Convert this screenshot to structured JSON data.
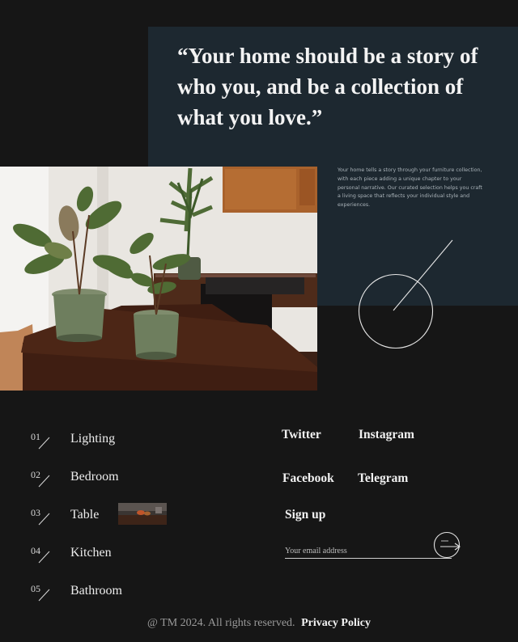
{
  "hero": {
    "quote": "“Your home should be a story of who you, and be a collection of what you love.”",
    "description": "Your home tells a story through your furniture collection, with each piece adding a unique chapter to your personal narrative. Our curated selection helps you craft a living space that reflects your individual style and experiences."
  },
  "categories": [
    {
      "number": "01",
      "label": "Lighting"
    },
    {
      "number": "02",
      "label": "Bedroom"
    },
    {
      "number": "03",
      "label": "Table"
    },
    {
      "number": "04",
      "label": "Kitchen"
    },
    {
      "number": "05",
      "label": "Bathroom"
    }
  ],
  "social": {
    "twitter": "Twitter",
    "instagram": "Instagram",
    "facebook": "Facebook",
    "telegram": "Telegram"
  },
  "newsletter": {
    "title": "Sign up",
    "placeholder": "Your email address"
  },
  "footer": {
    "copyright": "@ TM 2024. All rights reserved.",
    "policy": "Privacy Policy"
  },
  "colors": {
    "background": "#161616",
    "panel": "#1d2830",
    "text": "#ececec"
  }
}
